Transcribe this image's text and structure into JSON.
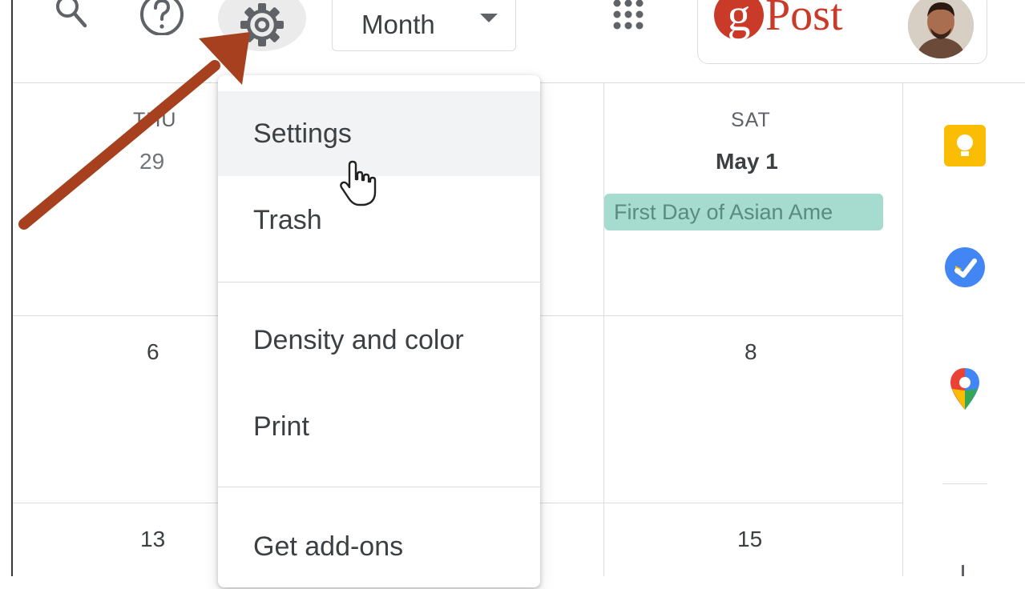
{
  "toolbar": {
    "view_select": {
      "value": "Month"
    },
    "brand": {
      "logo_letter": "g",
      "logo_text": "Post"
    }
  },
  "columns": {
    "thu": {
      "day_label": "THU",
      "dates": [
        "29",
        "6",
        "13"
      ]
    },
    "sat": {
      "day_label": "SAT",
      "dates": [
        "May 1",
        "8",
        "15"
      ]
    }
  },
  "events": [
    {
      "title": "First Day of Asian Ame",
      "color": "#a5dccf"
    }
  ],
  "settings_menu": {
    "items": [
      {
        "label": "Settings",
        "state": "hovered"
      },
      {
        "label": "Trash"
      },
      {
        "label": "Density and color"
      },
      {
        "label": "Print"
      },
      {
        "label": "Get add-ons"
      }
    ]
  },
  "side_panel": {
    "apps": [
      {
        "icon": "keep-icon",
        "color": "#fbbc04"
      },
      {
        "icon": "tasks-icon",
        "color": "#4285f4"
      },
      {
        "icon": "maps-icon",
        "color": "#34a853"
      }
    ]
  },
  "annotation": {
    "arrow_color": "#a6401e",
    "points_to": "settings-gear-button"
  }
}
